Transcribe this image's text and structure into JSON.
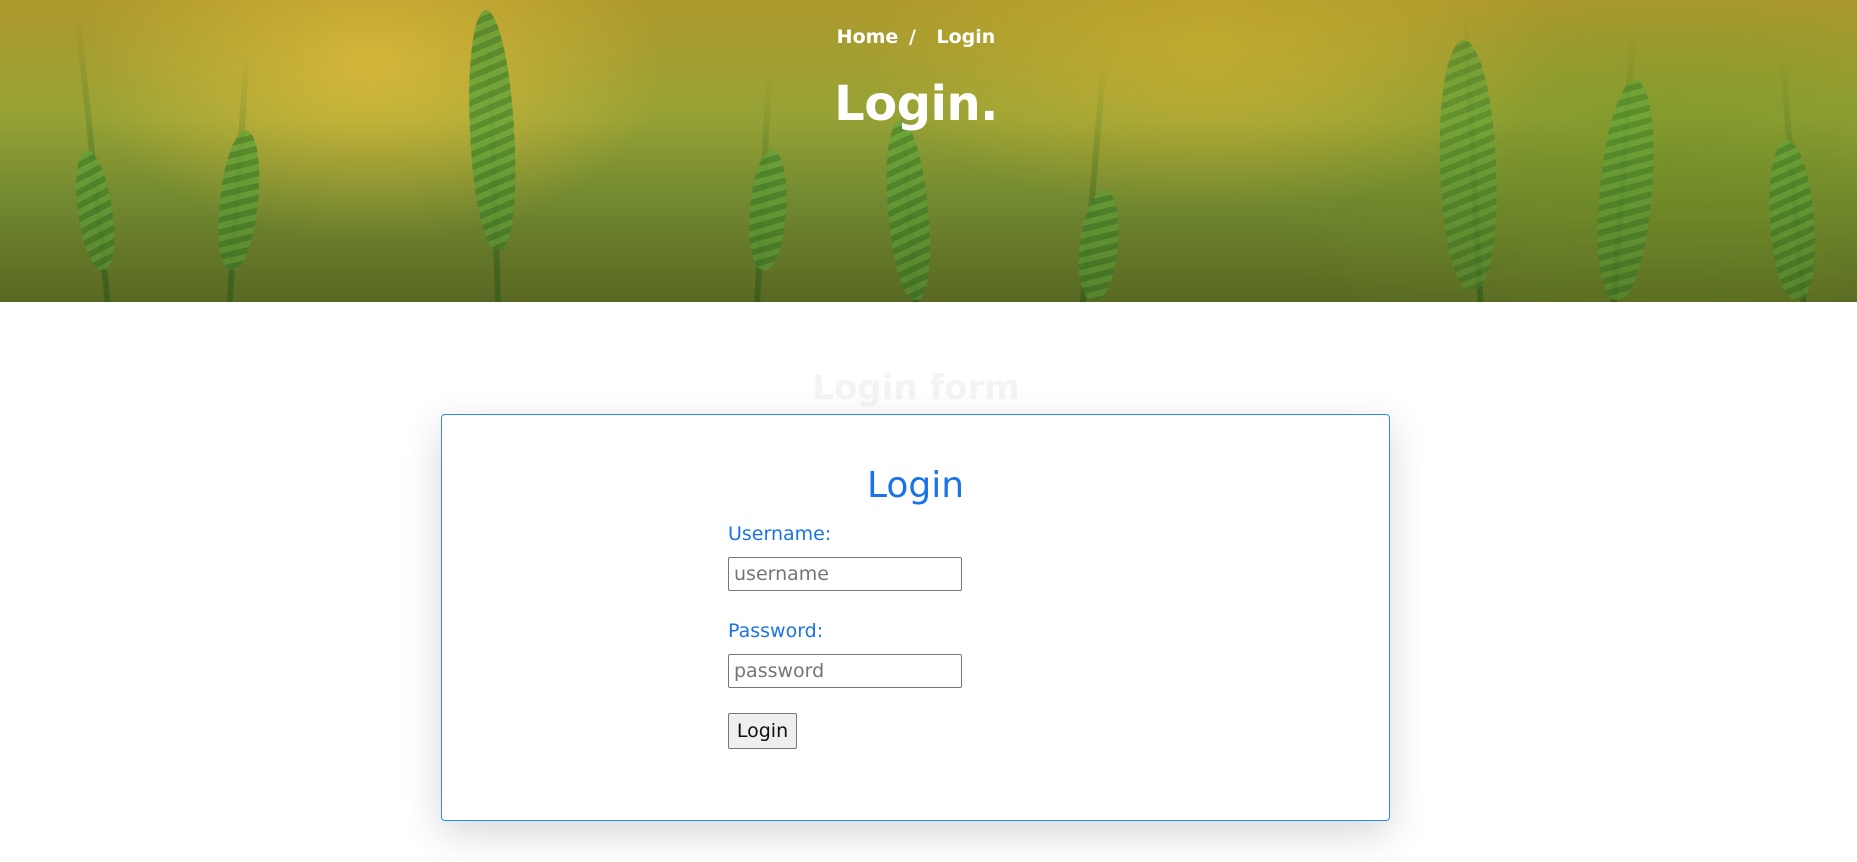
{
  "header": {
    "breadcrumb": {
      "home": "Home",
      "separator": "/",
      "current": "Login"
    },
    "title": "Login."
  },
  "section": {
    "heading": "Login form"
  },
  "login_card": {
    "title": "Login",
    "username": {
      "label": "Username:",
      "placeholder": "username",
      "value": ""
    },
    "password": {
      "label": "Password:",
      "placeholder": "password",
      "value": ""
    },
    "submit_label": "Login"
  },
  "colors": {
    "accent": "#1a73e8",
    "card_border": "#2d8cf0"
  }
}
